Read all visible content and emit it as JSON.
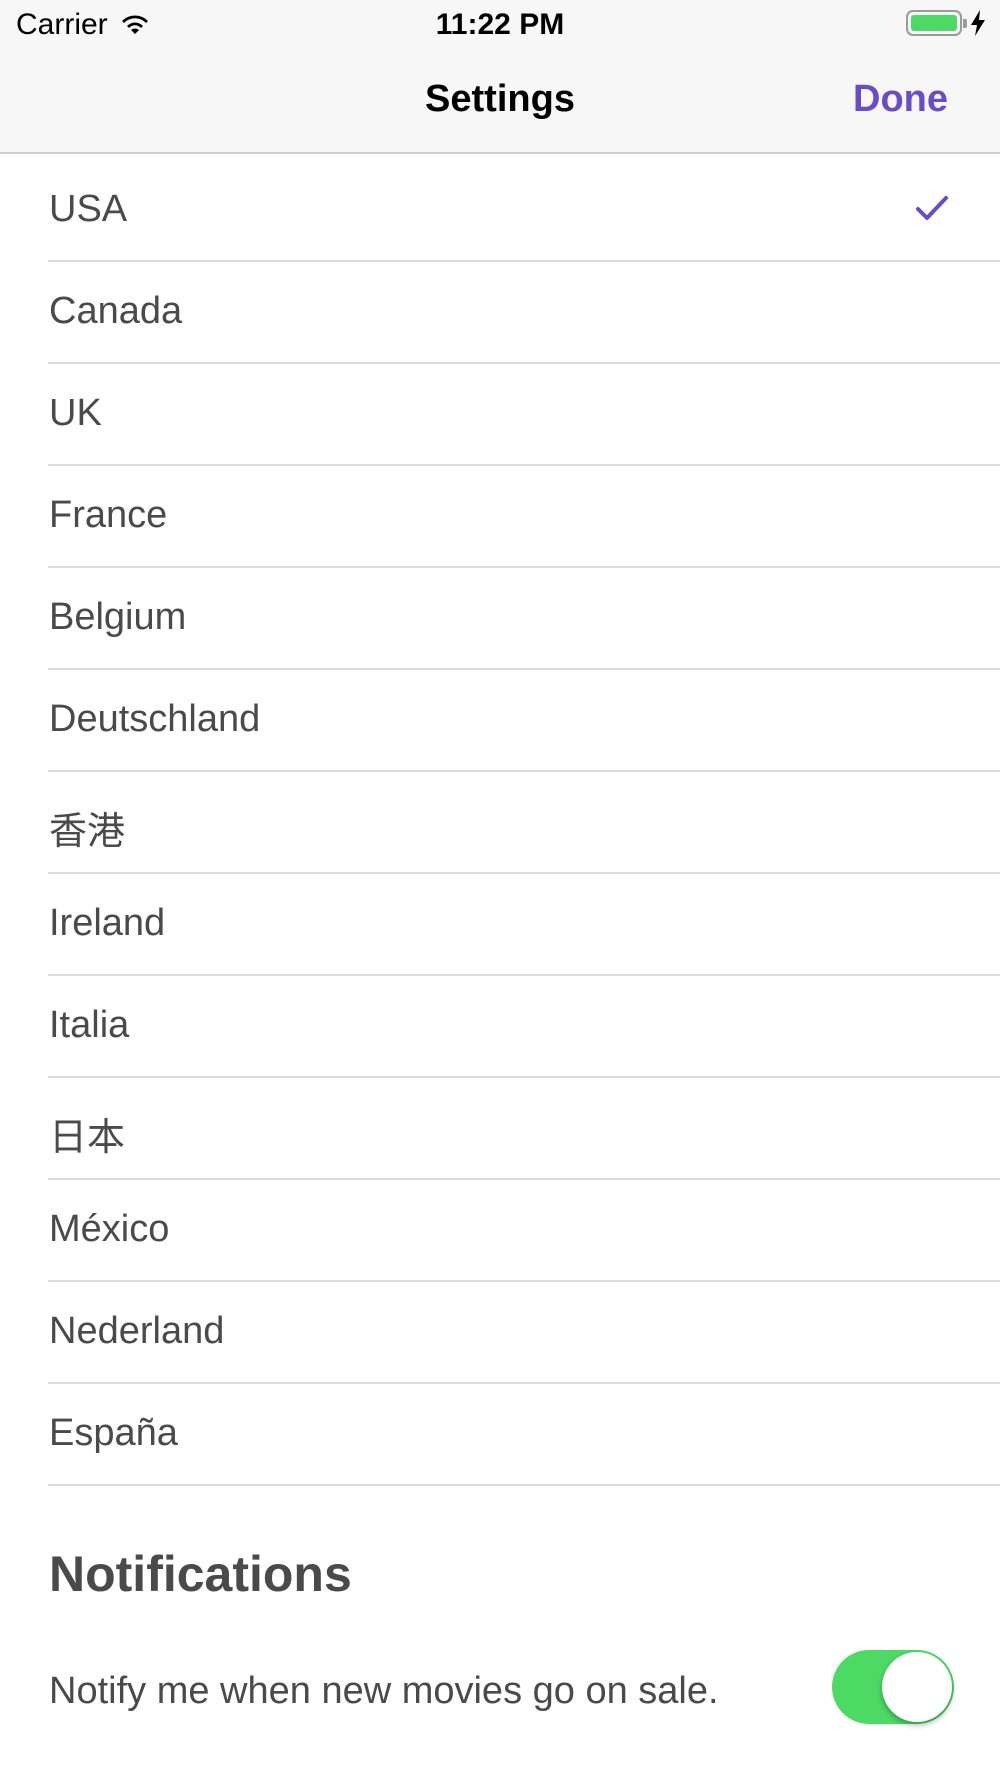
{
  "status_bar": {
    "carrier": "Carrier",
    "time": "11:22 PM",
    "battery_color": "#4cd964"
  },
  "nav": {
    "title": "Settings",
    "done_label": "Done",
    "accent_color": "#6a4cc8"
  },
  "countries": [
    {
      "label": "USA",
      "selected": true
    },
    {
      "label": "Canada",
      "selected": false
    },
    {
      "label": "UK",
      "selected": false
    },
    {
      "label": "France",
      "selected": false
    },
    {
      "label": "Belgium",
      "selected": false
    },
    {
      "label": "Deutschland",
      "selected": false
    },
    {
      "label": "香港",
      "selected": false
    },
    {
      "label": "Ireland",
      "selected": false
    },
    {
      "label": "Italia",
      "selected": false
    },
    {
      "label": "日本",
      "selected": false
    },
    {
      "label": "México",
      "selected": false
    },
    {
      "label": "Nederland",
      "selected": false
    },
    {
      "label": "España",
      "selected": false
    }
  ],
  "notifications": {
    "section_title": "Notifications",
    "label": "Notify me when new movies go on sale.",
    "enabled": true,
    "toggle_color": "#4cd964"
  },
  "icons": {
    "wifi": "wifi-icon",
    "battery": "battery-icon",
    "charging": "charging-bolt-icon",
    "checkmark": "checkmark-icon"
  }
}
